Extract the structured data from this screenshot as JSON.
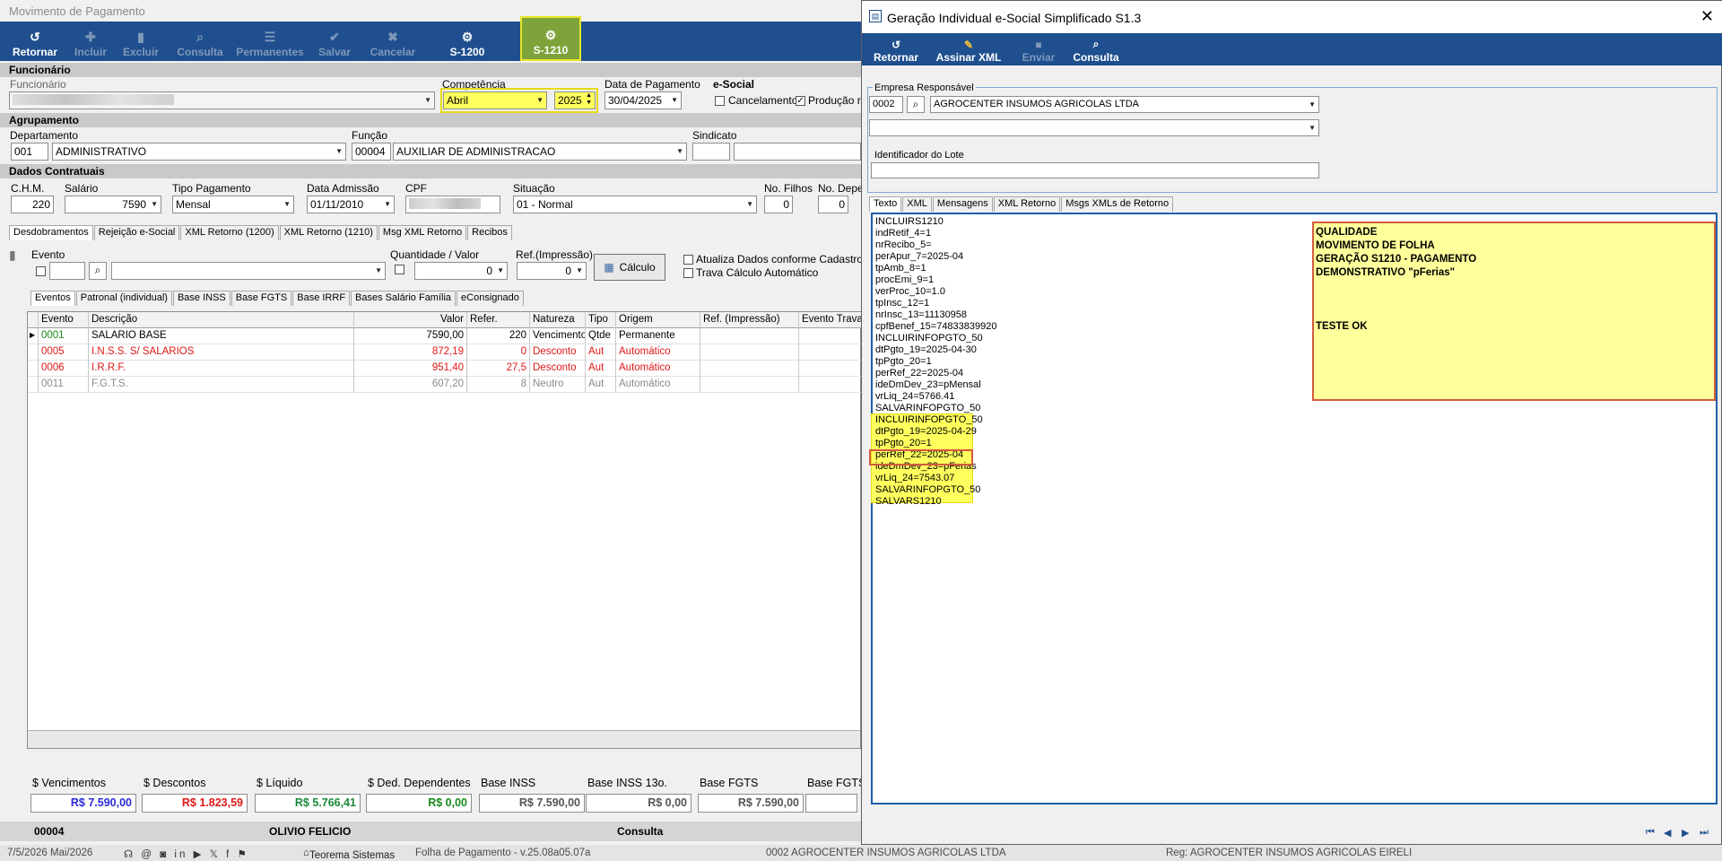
{
  "left": {
    "window_title": "Movimento de Pagamento",
    "toolbar": [
      {
        "label": "Retornar",
        "icon": "↺",
        "enabled": true
      },
      {
        "label": "Incluir",
        "icon": "✚",
        "enabled": false
      },
      {
        "label": "Excluir",
        "icon": "▮",
        "enabled": false
      },
      {
        "label": "Consulta",
        "icon": "⌕",
        "enabled": false
      },
      {
        "label": "Permanentes",
        "icon": "☰",
        "enabled": false
      },
      {
        "label": "Salvar",
        "icon": "✔",
        "enabled": false
      },
      {
        "label": "Cancelar",
        "icon": "✖",
        "enabled": false
      },
      {
        "label": "S-1200",
        "icon": "⚙",
        "enabled": true
      },
      {
        "label": "S-1210",
        "icon": "⚙",
        "enabled": true
      }
    ],
    "sec_funcionario": "Funcionário",
    "funcionario_label": "Funcionário",
    "competencia_label": "Competência",
    "competencia_mes": "Abril",
    "competencia_ano": "2025",
    "data_pagamento_label": "Data de Pagamento",
    "data_pagamento": "30/04/2025",
    "esocial_label": "e-Social",
    "cancelamento_label": "Cancelamento",
    "producao_label": "Produção re",
    "sec_agrupamento": "Agrupamento",
    "departamento_label": "Departamento",
    "departamento_cod": "001",
    "departamento_nome": "ADMINISTRATIVO",
    "funcao_label": "Função",
    "funcao_cod": "00004",
    "funcao_nome": "AUXILIAR DE ADMINISTRACAO",
    "sindicato_label": "Sindicato",
    "sec_dados": "Dados Contratuais",
    "chm_label": "C.H.M.",
    "chm": "220",
    "salario_label": "Salário",
    "salario": "7590",
    "tipo_pag_label": "Tipo Pagamento",
    "tipo_pag": "Mensal",
    "admissao_label": "Data Admissão",
    "admissao": "01/11/2010",
    "cpf_label": "CPF",
    "situacao_label": "Situação",
    "situacao": "01 - Normal",
    "filhos_label": "No. Filhos",
    "filhos": "0",
    "depe_label": "No. Depe",
    "depe": "0",
    "tabs1": [
      "Desdobramentos",
      "Rejeição e-Social",
      "XML Retorno (1200)",
      "XML Retorno (1210)",
      "Msg XML Retorno",
      "Recibos"
    ],
    "evento_label": "Evento",
    "qtd_label": "Quantidade / Valor",
    "qtd_value": "0",
    "refimp_label": "Ref.(Impressão)",
    "refimp_value": "0",
    "calculo_label": "Cálculo",
    "atualiza_label": "Atualiza Dados conforme Cadastro",
    "trava_label": "Trava Cálculo Automático",
    "tabs2": [
      "Eventos",
      "Patronal (individual)",
      "Base INSS",
      "Base FGTS",
      "Base IRRF",
      "Bases Salário Família",
      "eConsignado"
    ],
    "grid_headers": [
      "Evento",
      "Descrição",
      "Valor",
      "Refer.",
      "Natureza",
      "Tipo",
      "Origem",
      "Ref. (Impressão)",
      "Evento Travad"
    ],
    "grid_rows": [
      {
        "evento": "0001",
        "descricao": "SALARIO BASE",
        "valor": "7590,00",
        "refer": "220",
        "natureza": "Vencimento",
        "tipo": "Qtde",
        "origem": "Permanente",
        "color": "#000000",
        "code_color": "#1a8a1a"
      },
      {
        "evento": "0005",
        "descricao": "I.N.S.S. S/ SALARIOS",
        "valor": "872,19",
        "refer": "0",
        "natureza": "Desconto",
        "tipo": "Aut",
        "origem": "Automático",
        "color": "#e01818",
        "code_color": "#e01818"
      },
      {
        "evento": "0006",
        "descricao": "I.R.R.F.",
        "valor": "951,40",
        "refer": "27,5",
        "natureza": "Desconto",
        "tipo": "Aut",
        "origem": "Automático",
        "color": "#e01818",
        "code_color": "#e01818"
      },
      {
        "evento": "0011",
        "descricao": "F.G.T.S.",
        "valor": "607,20",
        "refer": "8",
        "natureza": "Neutro",
        "tipo": "Aut",
        "origem": "Automático",
        "color": "#8a8a8a",
        "code_color": "#8a8a8a"
      }
    ],
    "totals": [
      {
        "label": "$ Vencimentos",
        "value": "R$ 7.590,00",
        "color": "#2a2ad6"
      },
      {
        "label": "$ Descontos",
        "value": "R$ 1.823,59",
        "color": "#e01818"
      },
      {
        "label": "$ Líquido",
        "value": "R$ 5.766,41",
        "color": "#1a8a3a"
      },
      {
        "label": "$ Ded. Dependentes",
        "value": "R$ 0,00",
        "color": "#1a8a1a"
      },
      {
        "label": "Base INSS",
        "value": "R$ 7.590,00",
        "color": "#555555"
      },
      {
        "label": "Base INSS 13o.",
        "value": "R$ 0,00",
        "color": "#555555"
      },
      {
        "label": "Base FGTS",
        "value": "R$ 7.590,00",
        "color": "#555555"
      },
      {
        "label": "Base FGTS",
        "value": "",
        "color": "#555555"
      }
    ],
    "status_code": "00004",
    "status_name": "OLIVIO FELICIO",
    "status_mode": "Consulta"
  },
  "right": {
    "window_title": "Geração Individual e-Social Simplificado S1.3",
    "toolbar": [
      {
        "label": "Retornar",
        "icon": "↺",
        "enabled": true
      },
      {
        "label": "Assinar XML",
        "icon": "✎",
        "enabled": true
      },
      {
        "label": "Enviar",
        "icon": "■",
        "enabled": false
      },
      {
        "label": "Consulta",
        "icon": "⌕",
        "enabled": true
      }
    ],
    "empresa_label": "Empresa Responsável",
    "empresa_cod": "0002",
    "empresa_nome": "AGROCENTER INSUMOS AGRICOLAS LTDA",
    "lote_label": "Identificador do Lote",
    "tabs": [
      "Texto",
      "XML",
      "Mensagens",
      "XML Retorno",
      "Msgs XMLs de Retorno"
    ],
    "memo_lines": [
      "INCLUIRS1210",
      "indRetif_4=1",
      "nrRecibo_5=",
      "perApur_7=2025-04",
      "tpAmb_8=1",
      "procEmi_9=1",
      "verProc_10=1.0",
      "tpInsc_12=1",
      "nrInsc_13=11130958",
      "cpfBenef_15=74833839920",
      "INCLUIRINFOPGTO_50",
      "dtPgto_19=2025-04-30",
      "tpPgto_20=1",
      "perRef_22=2025-04",
      "ideDmDev_23=pMensal",
      "vrLiq_24=5766.41",
      "SALVARINFOPGTO_50",
      "INCLUIRINFOPGTO_50",
      "dtPgto_19=2025-04-29",
      "tpPgto_20=1",
      "perRef_22=2025-04",
      "ideDmDev_23=pFerias",
      "vrLiq_24=7543.07",
      "SALVARINFOPGTO_50",
      "SALVARS1210"
    ],
    "note_lines": [
      "QUALIDADE",
      "MOVIMENTO DE FOLHA",
      "GERAÇÃO S1210 - PAGAMENTO",
      "DEMONSTRATIVO \"pFerias\"",
      "",
      "",
      "",
      "TESTE OK"
    ]
  },
  "footer": {
    "date": "7/5/2026 Mai/2026",
    "company_brand": "Teorema Sistemas",
    "app": "Folha de Pagamento - v.25.08a05.07a",
    "empresa": "0002 AGROCENTER INSUMOS AGRICOLAS LTDA",
    "reg": "Reg: AGROCENTER INSUMOS AGRICOLAS EIRELI"
  }
}
